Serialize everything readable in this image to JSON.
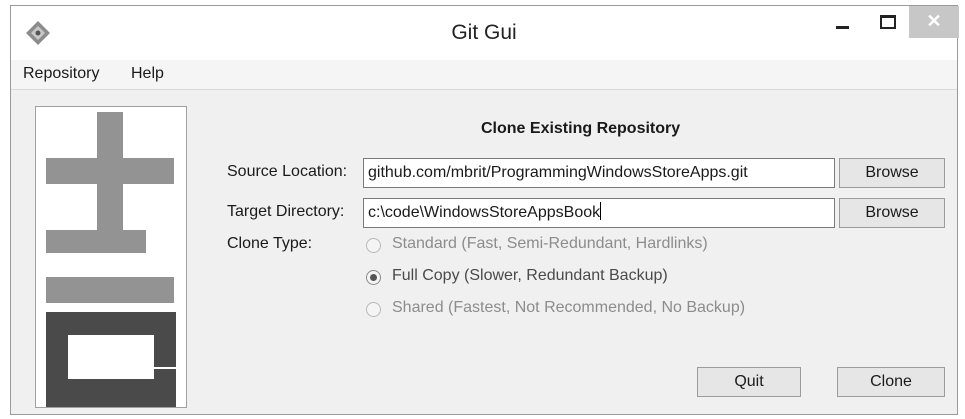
{
  "window": {
    "title": "Git Gui"
  },
  "menu": [
    {
      "label": "Repository"
    },
    {
      "label": "Help"
    }
  ],
  "dialog": {
    "heading": "Clone Existing Repository",
    "source": {
      "label": "Source Location:",
      "value": "github.com/mbrit/ProgrammingWindowsStoreApps.git",
      "browse": "Browse"
    },
    "target": {
      "label": "Target Directory:",
      "value": "c:\\code\\WindowsStoreAppsBook",
      "browse": "Browse"
    },
    "clone_type": {
      "label": "Clone Type:",
      "options": [
        {
          "label": "Standard (Fast, Semi-Redundant, Hardlinks)",
          "selected": false
        },
        {
          "label": "Full Copy (Slower, Redundant Backup)",
          "selected": true
        },
        {
          "label": "Shared (Fastest, Not Recommended, No Backup)",
          "selected": false
        }
      ]
    },
    "quit": "Quit",
    "clone": "Clone"
  },
  "colors": {
    "logo_dark": "#4a4a4a",
    "logo_light": "#939393",
    "close_button": "#c7c7c7"
  }
}
